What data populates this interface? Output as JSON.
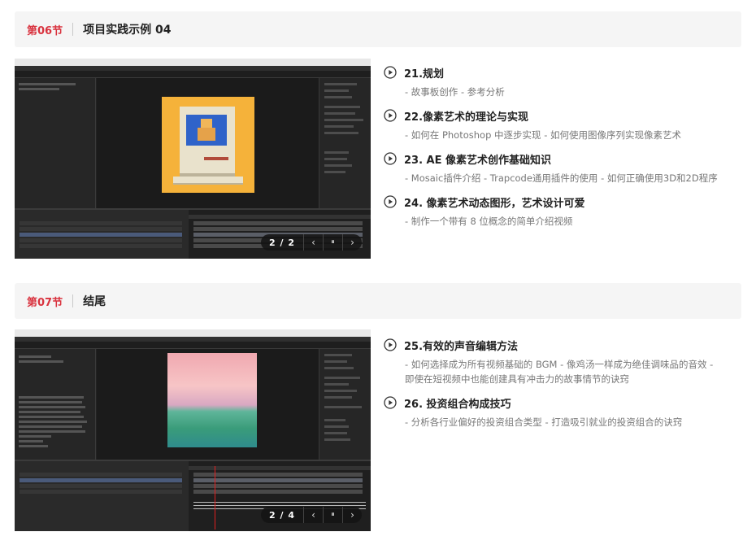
{
  "sections": [
    {
      "num": "第06节",
      "title": "项目实践示例 04",
      "pager": {
        "count": "2 / 2",
        "prev": "‹",
        "pause": "⏸",
        "next": "›"
      },
      "items": [
        {
          "title": "21.规划",
          "desc": [
            "- 故事板创作 - 参考分析"
          ]
        },
        {
          "title": "22.像素艺术的理论与实现",
          "desc": [
            "- 如何在 Photoshop 中逐步实现 - 如何使用图像序列实现像素艺术"
          ]
        },
        {
          "title": "23. AE 像素艺术创作基础知识",
          "desc": [
            "- Mosaic插件介绍 - Trapcode通用插件的使用 - 如何正确使用3D和2D程序"
          ]
        },
        {
          "title": "24. 像素艺术动态图形，艺术设计可爱",
          "desc": [
            "- 制作一个带有 8 位概念的简单介绍视频"
          ]
        }
      ]
    },
    {
      "num": "第07节",
      "title": "结尾",
      "pager": {
        "count": "2 / 4",
        "prev": "‹",
        "pause": "⏸",
        "next": "›"
      },
      "items": [
        {
          "title": "25.有效的声音编辑方法",
          "desc": [
            "- 如何选择成为所有视频基础的 BGM - 像鸡汤一样成为绝佳调味品的音效 -",
            "即使在短视频中也能创建具有冲击力的故事情节的诀窍"
          ]
        },
        {
          "title": "26. 投资组合构成技巧",
          "desc": [
            "- 分析各行业偏好的投资组合类型 - 打造吸引就业的投资组合的诀窍"
          ]
        }
      ]
    }
  ],
  "colors": {
    "accent": "#d9333f",
    "header_bg": "#f5f5f5"
  },
  "icons": {
    "item": "play-circle-icon",
    "prev": "chevron-left-icon",
    "pause": "pause-icon",
    "next": "chevron-right-icon"
  }
}
